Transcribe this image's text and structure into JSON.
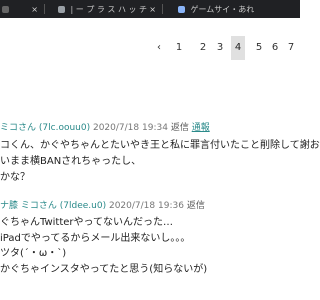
{
  "browser": {
    "tabs": [
      {
        "title": "",
        "icon": "blank-tab-icon"
      },
      {
        "title": "| ー プ ラ ス ハ ッ チ",
        "icon": "page-icon"
      },
      {
        "title": "ゲームサイ・あれ",
        "icon": "twitter-icon"
      }
    ],
    "close_glyph": "×"
  },
  "pagination": {
    "prev": "‹",
    "pages": [
      "1",
      "2",
      "3",
      "4",
      "5",
      "6",
      "7"
    ],
    "active": "4"
  },
  "posts": [
    {
      "author": "ミコさん",
      "id": "(7lc.oouu0)",
      "date": "2020/7/18 19:34",
      "reply_label": "返信",
      "report_label": "通報",
      "lines": [
        "コくん、かぐやちゃんとたいやき王と私に罪言付いたこと削除して謝おう",
        "いまま横BANされちゃったし、",
        "かな？"
      ]
    },
    {
      "author_prefix": "ナ膝",
      "author": "ミコさん",
      "id": "(7ldee.u0)",
      "date": "2020/7/18 19:36",
      "reply_label": "返信",
      "lines": [
        "ぐちゃんTwitterやってないんだった…",
        "iPadでやってるからメール出来ないし。。。",
        "ツタ(´・ω・`)",
        "かぐちゃインスタやってたと思う(知らないが)"
      ]
    }
  ]
}
